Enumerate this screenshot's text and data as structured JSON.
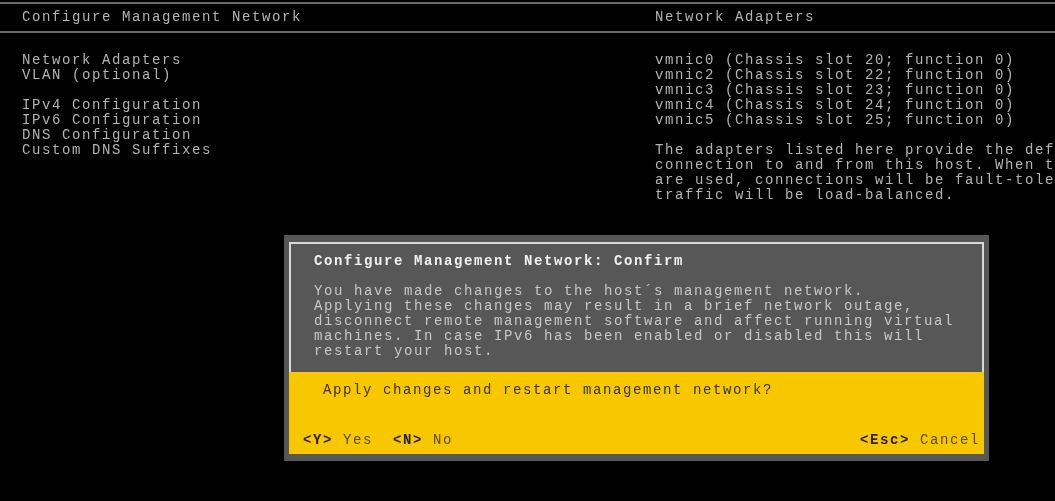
{
  "header": {
    "left_title": "Configure Management Network",
    "right_title": "Network Adapters"
  },
  "menu": {
    "groups": [
      {
        "items": [
          {
            "label": "Network Adapters"
          },
          {
            "label": "VLAN (optional)"
          }
        ]
      },
      {
        "items": [
          {
            "label": "IPv4 Configuration"
          },
          {
            "label": "IPv6 Configuration"
          },
          {
            "label": "DNS Configuration"
          },
          {
            "label": "Custom DNS Suffixes"
          }
        ]
      }
    ]
  },
  "adapters": [
    "vmnic0 (Chassis slot 20; function 0)",
    "vmnic2 (Chassis slot 22; function 0)",
    "vmnic3 (Chassis slot 23; function 0)",
    "vmnic4 (Chassis slot 24; function 0)",
    "vmnic5 (Chassis slot 25; function 0)"
  ],
  "description": [
    "The adapters listed here provide the def",
    "connection to and from this host. When t",
    "are used, connections will be fault-tole",
    "traffic will be load-balanced."
  ],
  "dialog": {
    "title": "Configure Management Network: Confirm",
    "message": [
      "You have made changes to the host´s management network.",
      "Applying these changes may result in a brief network outage,",
      "disconnect remote management software and affect running virtual",
      "machines. In case IPv6 has been enabled or disabled this will",
      "restart your host."
    ],
    "question": "Apply changes and restart management network?",
    "actions_left": [
      {
        "key": "<Y>",
        "label": "Yes"
      },
      {
        "key": "<N>",
        "label": "No"
      }
    ],
    "actions_right": [
      {
        "key": "<Esc>",
        "label": "Cancel"
      }
    ]
  }
}
